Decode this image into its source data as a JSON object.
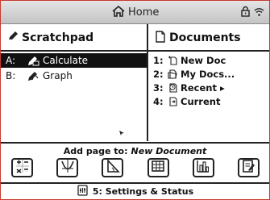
{
  "titlebar": {
    "title": "Home",
    "icons": [
      "home-icon",
      "lock-icon",
      "wifi-icon"
    ]
  },
  "scratchpad": {
    "heading": "Scratchpad",
    "items": [
      {
        "key": "A:",
        "label": "Calculate",
        "icon": "calculator-scratch-icon",
        "selected": true
      },
      {
        "key": "B:",
        "label": "Graph",
        "icon": "graph-scratch-icon",
        "selected": false
      }
    ]
  },
  "documents": {
    "heading": "Documents",
    "items": [
      {
        "key": "1:",
        "label": "New Doc",
        "icon": "new-doc-icon"
      },
      {
        "key": "2:",
        "label": "My Docs...",
        "icon": "folder-icon"
      },
      {
        "key": "3:",
        "label": "Recent ▸",
        "icon": "recent-icon"
      },
      {
        "key": "4:",
        "label": "Current",
        "icon": "current-doc-icon"
      }
    ]
  },
  "addpage": {
    "label": "Add page to:",
    "target": "New Document",
    "apps": [
      "calculator-app-icon",
      "graphs-app-icon",
      "geometry-app-icon",
      "lists-spreadsheet-app-icon",
      "data-statistics-app-icon",
      "notes-app-icon"
    ]
  },
  "settings": {
    "label": "5:  Settings & Status",
    "icon": "settings-icon"
  },
  "colors": {
    "frame_border": "#c83a2e",
    "selection_bg": "#111111",
    "titlebar_bg": "#d6d6d6"
  }
}
